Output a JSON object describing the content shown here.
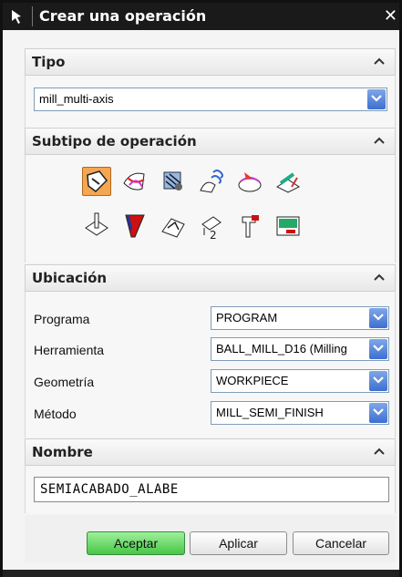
{
  "window": {
    "title": "Crear una operación",
    "close_label": "✕"
  },
  "tipo": {
    "header": "Tipo",
    "value": "mill_multi-axis"
  },
  "subtipo": {
    "header": "Subtipo de operación",
    "icons_row1": [
      "contour-profile-icon",
      "variable-axis-surface-icon",
      "streamline-icon",
      "flow-cut-icon",
      "zlevel-icon",
      "rotary-icon"
    ],
    "icons_row2": [
      "drill-axis-icon",
      "tapered-tool-icon",
      "multi-blade-icon",
      "swarf-icon",
      "fixed-axis-icon",
      "mill-user-icon"
    ]
  },
  "ubicacion": {
    "header": "Ubicación",
    "fields": [
      {
        "label": "Programa",
        "value": "PROGRAM"
      },
      {
        "label": "Herramienta",
        "value": "BALL_MILL_D16 (Milling"
      },
      {
        "label": "Geometría",
        "value": "WORKPIECE"
      },
      {
        "label": "Método",
        "value": "MILL_SEMI_FINISH"
      }
    ]
  },
  "nombre": {
    "header": "Nombre",
    "value": "SEMIACABADO_ALABE"
  },
  "buttons": {
    "accept": "Aceptar",
    "apply": "Aplicar",
    "cancel": "Cancelar"
  },
  "colors": {
    "accept": "#47c647",
    "combo_button": "#3d6fd0",
    "selected_icon": "#f5a650"
  }
}
